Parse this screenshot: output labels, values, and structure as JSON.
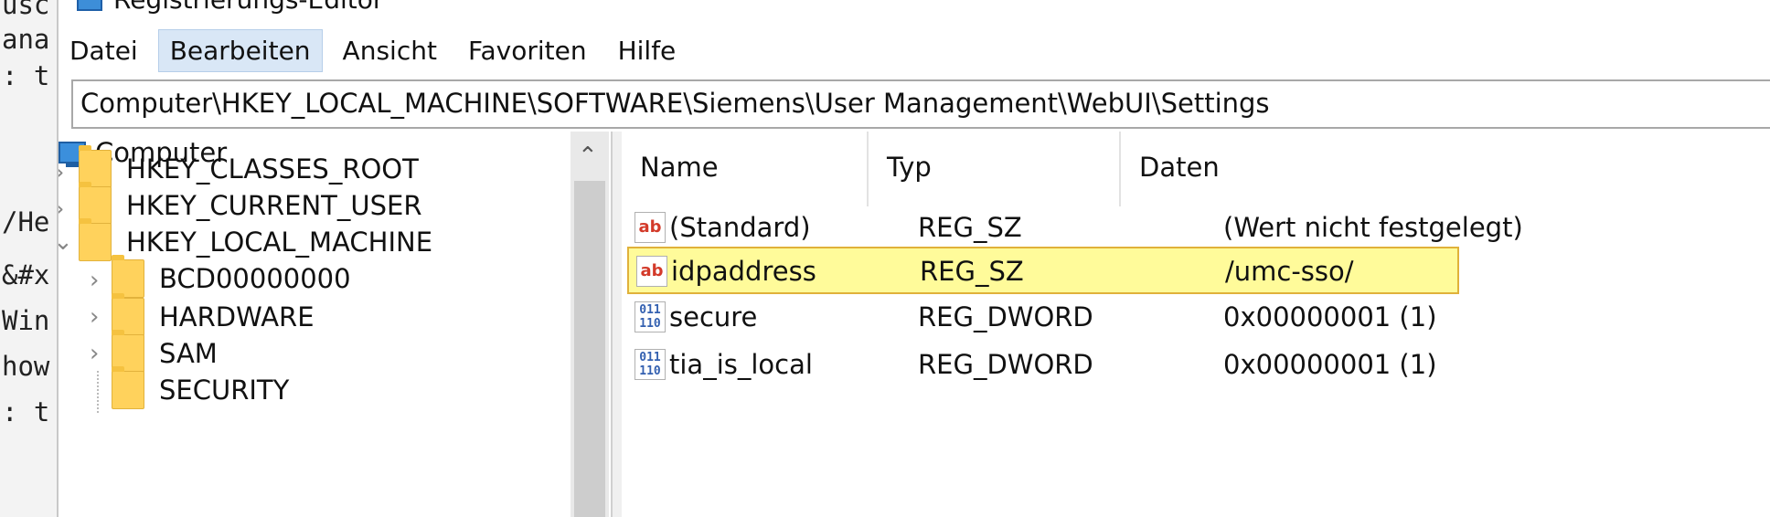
{
  "background_terminal_lines": [
    "usc",
    "ana",
    ": t",
    "/He",
    "&#x",
    "Win",
    "how",
    ": t"
  ],
  "window": {
    "title": "Registrierungs-Editor"
  },
  "menu": [
    "Datei",
    "Bearbeiten",
    "Ansicht",
    "Favoriten",
    "Hilfe"
  ],
  "active_menu": "Bearbeiten",
  "address": "Computer\\HKEY_LOCAL_MACHINE\\SOFTWARE\\Siemens\\User Management\\WebUI\\Settings",
  "tree": {
    "root": "Computer",
    "hives": [
      "HKEY_CLASSES_ROOT",
      "HKEY_CURRENT_USER",
      "HKEY_LOCAL_MACHINE"
    ],
    "hklm_children": [
      "BCD00000000",
      "HARDWARE",
      "SAM",
      "SECURITY"
    ]
  },
  "columns": {
    "name": "Name",
    "type": "Typ",
    "data": "Daten"
  },
  "values": [
    {
      "name": "(Standard)",
      "type": "REG_SZ",
      "data": "(Wert nicht festgelegt)",
      "icon": "string-value-icon",
      "glyph": "ab"
    },
    {
      "name": "idpaddress",
      "type": "REG_SZ",
      "data": "/umc-sso/",
      "icon": "string-value-icon",
      "glyph": "ab",
      "selected": true
    },
    {
      "name": "secure",
      "type": "REG_DWORD",
      "data": "0x00000001 (1)",
      "icon": "dword-value-icon",
      "glyph": "011\n110"
    },
    {
      "name": "tia_is_local",
      "type": "REG_DWORD",
      "data": "0x00000001 (1)",
      "icon": "dword-value-icon",
      "glyph": "011\n110"
    }
  ],
  "colors": {
    "selection_fill": "#fffb9a",
    "selection_border": "#e0b13a",
    "menu_active": "#d9e7f6",
    "folder": "#ffd25c"
  }
}
